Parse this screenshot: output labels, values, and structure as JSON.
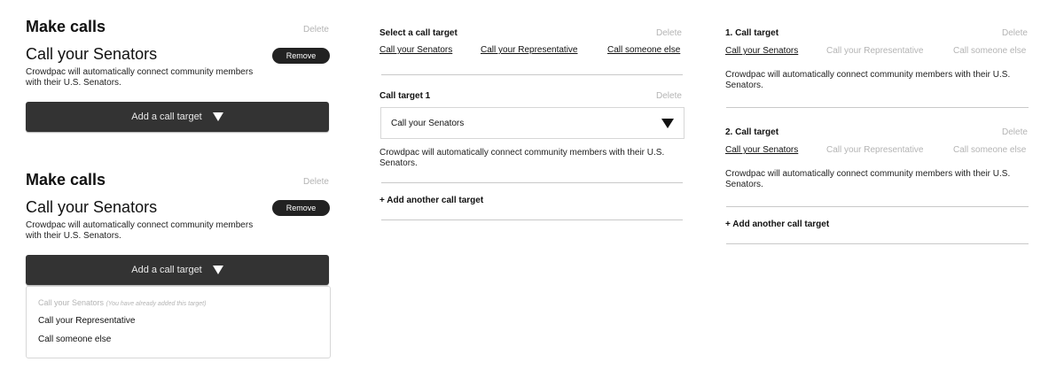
{
  "col1": {
    "block1": {
      "heading": "Make calls",
      "delete_label": "Delete",
      "target_title": "Call your Senators",
      "remove_label": "Remove",
      "description": "Crowdpac will automatically connect community members with their U.S. Senators.",
      "add_target_label": "Add a call target"
    },
    "block2": {
      "heading": "Make calls",
      "delete_label": "Delete",
      "target_title": "Call your Senators",
      "remove_label": "Remove",
      "description": "Crowdpac will automatically connect community members with their U.S. Senators.",
      "add_target_label": "Add a call target",
      "dropdown": {
        "disabled_option": "Call your Senators",
        "disabled_note": "(You have already added this target)",
        "option_2": "Call your Representative",
        "option_3": "Call someone else"
      }
    }
  },
  "col2": {
    "select_heading": "Select a call target",
    "delete_label": "Delete",
    "options": [
      "Call your Senators",
      "Call your Representative",
      "Call someone else"
    ],
    "target1": {
      "heading": "Call target 1",
      "delete_label": "Delete",
      "selected_value": "Call your Senators",
      "description": "Crowdpac will automatically connect community members with their U.S. Senators."
    },
    "add_another": "+ Add another call target"
  },
  "col3": {
    "target1": {
      "heading": "1. Call target",
      "delete_label": "Delete",
      "options": [
        "Call your Senators",
        "Call your Representative",
        "Call someone else"
      ],
      "description": "Crowdpac will automatically connect community members with their U.S. Senators."
    },
    "target2": {
      "heading": "2. Call target",
      "delete_label": "Delete",
      "options": [
        "Call your Senators",
        "Call your Representative",
        "Call someone else"
      ],
      "description": "Crowdpac will automatically connect community members with their U.S. Senators."
    },
    "add_another": "+ Add another call target"
  }
}
